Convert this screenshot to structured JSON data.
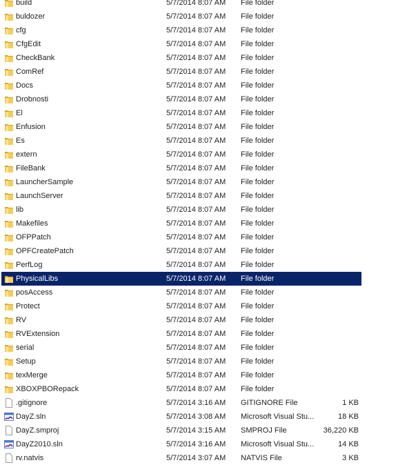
{
  "selected_index": 20,
  "colors": {
    "selection": "#0a246a",
    "folder": "#e8b830"
  },
  "files": [
    {
      "name": "build",
      "date": "5/7/2014 8:07 AM",
      "type": "File folder",
      "size": "",
      "icon": "folder-icon"
    },
    {
      "name": "buldozer",
      "date": "5/7/2014 8:07 AM",
      "type": "File folder",
      "size": "",
      "icon": "folder-icon"
    },
    {
      "name": "cfg",
      "date": "5/7/2014 8:07 AM",
      "type": "File folder",
      "size": "",
      "icon": "folder-icon"
    },
    {
      "name": "CfgEdit",
      "date": "5/7/2014 8:07 AM",
      "type": "File folder",
      "size": "",
      "icon": "folder-icon"
    },
    {
      "name": "CheckBank",
      "date": "5/7/2014 8:07 AM",
      "type": "File folder",
      "size": "",
      "icon": "folder-icon"
    },
    {
      "name": "ComRef",
      "date": "5/7/2014 8:07 AM",
      "type": "File folder",
      "size": "",
      "icon": "folder-icon"
    },
    {
      "name": "Docs",
      "date": "5/7/2014 8:07 AM",
      "type": "File folder",
      "size": "",
      "icon": "folder-icon"
    },
    {
      "name": "Drobnosti",
      "date": "5/7/2014 8:07 AM",
      "type": "File folder",
      "size": "",
      "icon": "folder-icon"
    },
    {
      "name": "El",
      "date": "5/7/2014 8:07 AM",
      "type": "File folder",
      "size": "",
      "icon": "folder-icon"
    },
    {
      "name": "Enfusion",
      "date": "5/7/2014 8:07 AM",
      "type": "File folder",
      "size": "",
      "icon": "folder-icon"
    },
    {
      "name": "Es",
      "date": "5/7/2014 8:07 AM",
      "type": "File folder",
      "size": "",
      "icon": "folder-icon"
    },
    {
      "name": "extern",
      "date": "5/7/2014 8:07 AM",
      "type": "File folder",
      "size": "",
      "icon": "folder-icon"
    },
    {
      "name": "FileBank",
      "date": "5/7/2014 8:07 AM",
      "type": "File folder",
      "size": "",
      "icon": "folder-icon"
    },
    {
      "name": "LauncherSample",
      "date": "5/7/2014 8:07 AM",
      "type": "File folder",
      "size": "",
      "icon": "folder-icon"
    },
    {
      "name": "LaunchServer",
      "date": "5/7/2014 8:07 AM",
      "type": "File folder",
      "size": "",
      "icon": "folder-icon"
    },
    {
      "name": "lib",
      "date": "5/7/2014 8:07 AM",
      "type": "File folder",
      "size": "",
      "icon": "folder-icon"
    },
    {
      "name": "Makefiles",
      "date": "5/7/2014 8:07 AM",
      "type": "File folder",
      "size": "",
      "icon": "folder-icon"
    },
    {
      "name": "OFPPatch",
      "date": "5/7/2014 8:07 AM",
      "type": "File folder",
      "size": "",
      "icon": "folder-icon"
    },
    {
      "name": "OPFCreatePatch",
      "date": "5/7/2014 8:07 AM",
      "type": "File folder",
      "size": "",
      "icon": "folder-icon"
    },
    {
      "name": "PerfLog",
      "date": "5/7/2014 8:07 AM",
      "type": "File folder",
      "size": "",
      "icon": "folder-icon"
    },
    {
      "name": "PhysicalLibs",
      "date": "5/7/2014 8:07 AM",
      "type": "File folder",
      "size": "",
      "icon": "folder-icon"
    },
    {
      "name": "posAccess",
      "date": "5/7/2014 8:07 AM",
      "type": "File folder",
      "size": "",
      "icon": "folder-icon"
    },
    {
      "name": "Protect",
      "date": "5/7/2014 8:07 AM",
      "type": "File folder",
      "size": "",
      "icon": "folder-icon"
    },
    {
      "name": "RV",
      "date": "5/7/2014 8:07 AM",
      "type": "File folder",
      "size": "",
      "icon": "folder-icon"
    },
    {
      "name": "RVExtension",
      "date": "5/7/2014 8:07 AM",
      "type": "File folder",
      "size": "",
      "icon": "folder-icon"
    },
    {
      "name": "serial",
      "date": "5/7/2014 8:07 AM",
      "type": "File folder",
      "size": "",
      "icon": "folder-icon"
    },
    {
      "name": "Setup",
      "date": "5/7/2014 8:07 AM",
      "type": "File folder",
      "size": "",
      "icon": "folder-icon"
    },
    {
      "name": "texMerge",
      "date": "5/7/2014 8:07 AM",
      "type": "File folder",
      "size": "",
      "icon": "folder-icon"
    },
    {
      "name": "XBOXPBORepack",
      "date": "5/7/2014 8:07 AM",
      "type": "File folder",
      "size": "",
      "icon": "folder-icon"
    },
    {
      "name": ".gitignore",
      "date": "5/7/2014 3:16 AM",
      "type": "GITIGNORE File",
      "size": "1 KB",
      "icon": "file-icon"
    },
    {
      "name": "DayZ.sln",
      "date": "5/7/2014 3:08 AM",
      "type": "Microsoft Visual Stu...",
      "size": "18 KB",
      "icon": "visual-studio-solution-icon"
    },
    {
      "name": "DayZ.smproj",
      "date": "5/7/2014 3:15 AM",
      "type": "SMPROJ File",
      "size": "36,220 KB",
      "icon": "file-icon"
    },
    {
      "name": "DayZ2010.sln",
      "date": "5/7/2014 3:16 AM",
      "type": "Microsoft Visual Stu...",
      "size": "14 KB",
      "icon": "visual-studio-solution-icon"
    },
    {
      "name": "rv.natvis",
      "date": "5/7/2014 3:07 AM",
      "type": "NATVIS File",
      "size": "3 KB",
      "icon": "file-icon"
    }
  ]
}
